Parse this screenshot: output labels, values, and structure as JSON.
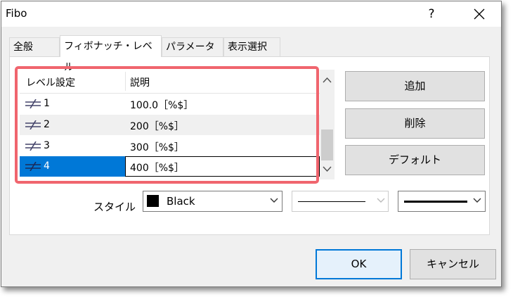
{
  "window": {
    "title": "Fibo",
    "help_label": "?"
  },
  "tabs": [
    {
      "label": "全般",
      "active": false
    },
    {
      "label": "フィボナッチ・レベル",
      "active": true
    },
    {
      "label": "パラメーター",
      "active": false
    },
    {
      "label": "表示選択",
      "active": false
    }
  ],
  "levels": {
    "columns": [
      "レベル設定",
      "説明"
    ],
    "rows": [
      {
        "level": "1",
        "description": "100.0［%$］"
      },
      {
        "level": "2",
        "description": "200［%$］"
      },
      {
        "level": "3",
        "description": "300［%$］"
      },
      {
        "level": "4",
        "description": "400［%$］",
        "selected": true
      }
    ],
    "icon": "not-equal-icon"
  },
  "buttons": {
    "add": "追加",
    "delete": "削除",
    "default": "デフォルト",
    "ok": "OK",
    "cancel": "キャンセル"
  },
  "style": {
    "label": "スタイル",
    "color_name": "Black",
    "color_value": "#000000"
  },
  "colors": {
    "highlight": "#f0656e",
    "selection": "#0078d7"
  }
}
